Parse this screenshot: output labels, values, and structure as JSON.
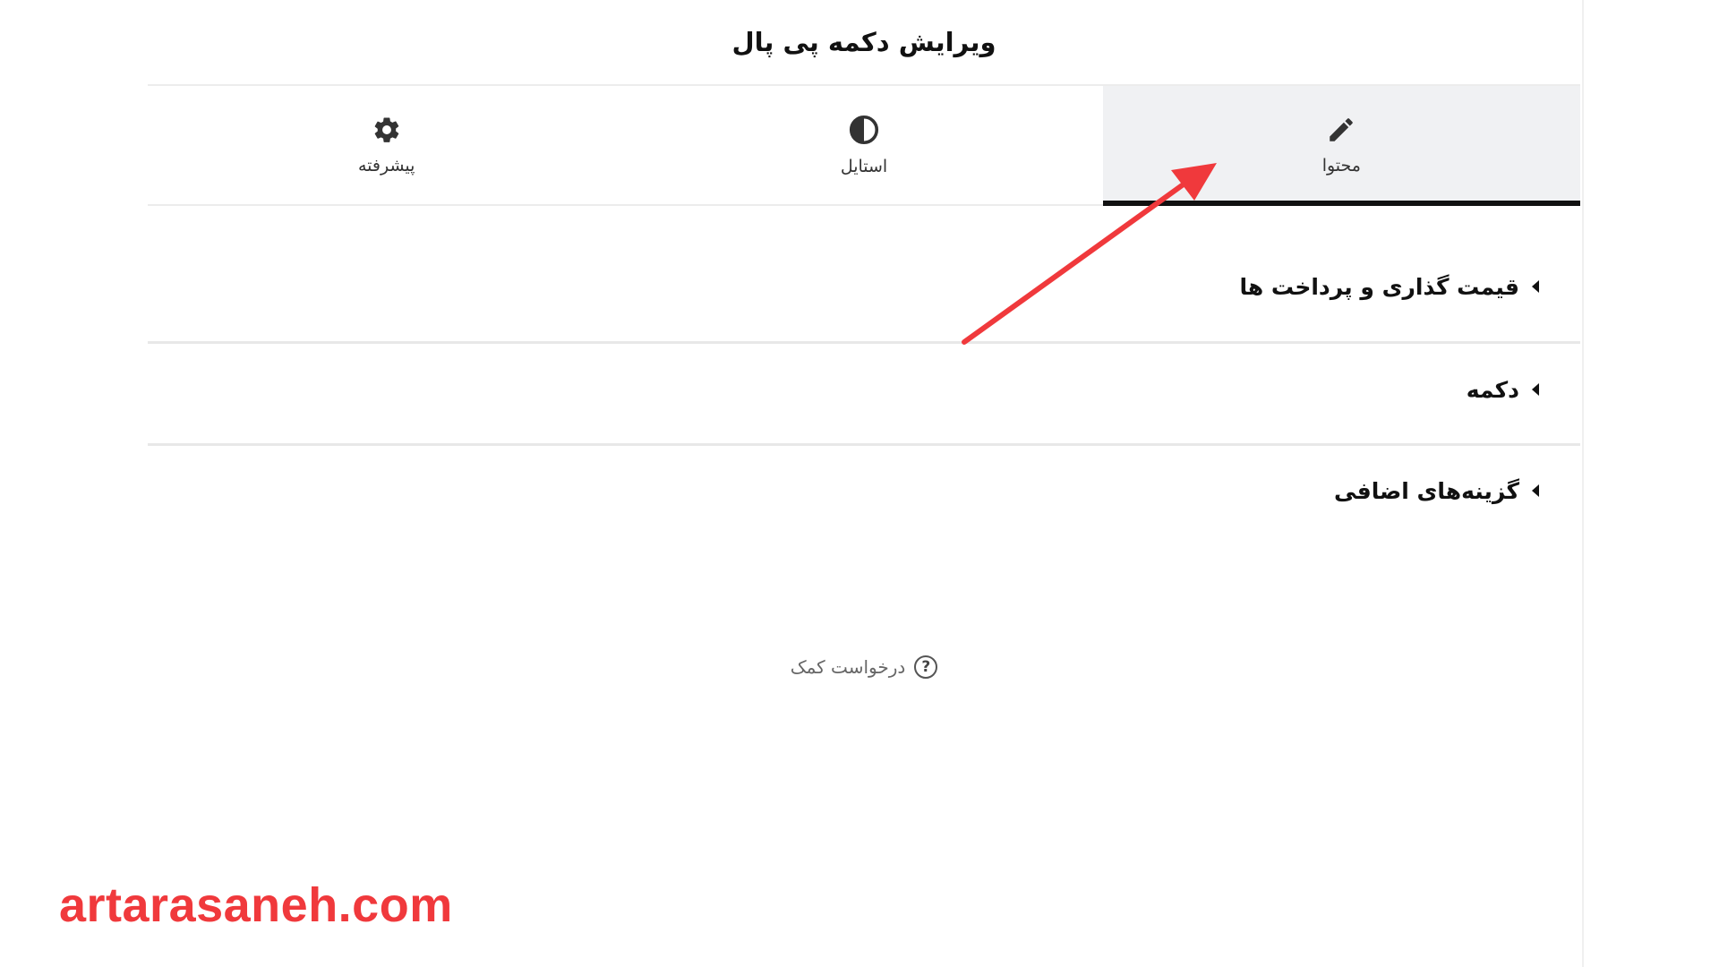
{
  "panel": {
    "title": "ویرایش دکمه پی پال"
  },
  "tabs": [
    {
      "label": "محتوا",
      "icon": "pencil-icon",
      "active": true
    },
    {
      "label": "استایل",
      "icon": "contrast-icon",
      "active": false
    },
    {
      "label": "پیشرفته",
      "icon": "gear-icon",
      "active": false
    }
  ],
  "sections": [
    {
      "label": "قیمت گذاری و پرداخت ها"
    },
    {
      "label": "دکمه"
    },
    {
      "label": "گزینه‌های اضافی"
    }
  ],
  "help": {
    "label": "درخواست کمک",
    "icon_glyph": "?"
  },
  "watermark": "artarasaneh.com",
  "colors": {
    "annotation_arrow": "#f0393c",
    "active_tab_bg": "#f0f1f3",
    "active_tab_underline": "#111111"
  }
}
